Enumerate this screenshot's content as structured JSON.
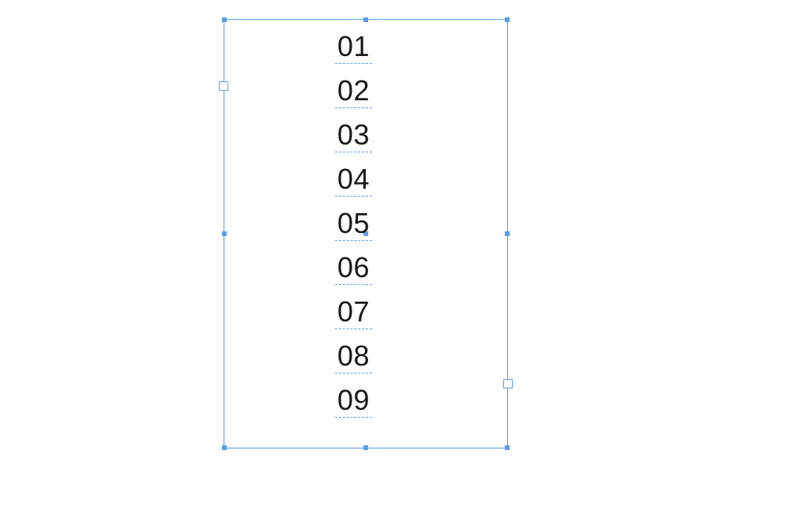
{
  "textbox": {
    "items": [
      "01",
      "02",
      "03",
      "04",
      "05",
      "06",
      "07",
      "08",
      "09"
    ]
  }
}
